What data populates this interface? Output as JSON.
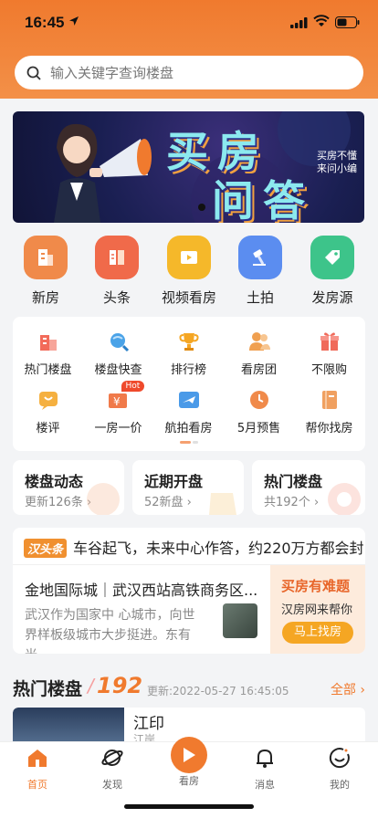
{
  "status": {
    "time": "16:45"
  },
  "search": {
    "placeholder": "输入关键字查询楼盘"
  },
  "banner": {
    "title_line1": "买房",
    "title_line2": "问答",
    "side_text": "买房不懂来问小编"
  },
  "categories": [
    {
      "label": "新房",
      "icon": "building-icon",
      "color": "#f08a4a"
    },
    {
      "label": "头条",
      "icon": "news-icon",
      "color": "#f06a4a"
    },
    {
      "label": "视频看房",
      "icon": "video-icon",
      "color": "#f5b82a"
    },
    {
      "label": "土拍",
      "icon": "gavel-icon",
      "color": "#5b8df0"
    },
    {
      "label": "发房源",
      "icon": "tag-icon",
      "color": "#3dc48a"
    }
  ],
  "grid": [
    {
      "label": "热门楼盘",
      "icon": "hot-building-icon",
      "color": "#f26b5a"
    },
    {
      "label": "楼盘快查",
      "icon": "search-globe-icon",
      "color": "#4aa3e8"
    },
    {
      "label": "排行榜",
      "icon": "trophy-icon",
      "color": "#f5a623"
    },
    {
      "label": "看房团",
      "icon": "group-icon",
      "color": "#f0a050"
    },
    {
      "label": "不限购",
      "icon": "gift-icon",
      "color": "#f06a5a"
    },
    {
      "label": "楼评",
      "icon": "comment-icon",
      "color": "#f5b040"
    },
    {
      "label": "一房一价",
      "icon": "price-icon",
      "color": "#f07a4a",
      "badge": "Hot"
    },
    {
      "label": "航拍看房",
      "icon": "plane-icon",
      "color": "#4a9ae8"
    },
    {
      "label": "5月预售",
      "icon": "clock-icon",
      "color": "#f08a4a"
    },
    {
      "label": "帮你找房",
      "icon": "book-icon",
      "color": "#f0a060"
    }
  ],
  "stats": [
    {
      "title": "楼盘动态",
      "sub": "更新126条"
    },
    {
      "title": "近期开盘",
      "sub": "52新盘"
    },
    {
      "title": "热门楼盘",
      "sub": "共192个"
    }
  ],
  "news": {
    "tag": "汉头条",
    "headline": "车谷起飞，未来中心作答，约220万方都会封",
    "title": "金地国际城｜武汉西站高铁商务区...",
    "body": "武汉作为国家中 心城市，向世界样板级城市大步挺进。东有光...",
    "promo_title": "买房有难题",
    "promo_sub": "汉房网来帮你",
    "promo_button": "马上找房"
  },
  "hot_section": {
    "title": "热门楼盘",
    "count": "192",
    "updated": "更新:2022-05-27 16:45:05",
    "all_label": "全部"
  },
  "listing": {
    "name": "江印",
    "sub": "江岸"
  },
  "tabbar": [
    {
      "label": "首页",
      "icon": "home-icon",
      "active": true
    },
    {
      "label": "发现",
      "icon": "planet-icon",
      "active": false
    },
    {
      "label": "看房",
      "icon": "play-icon",
      "active": false
    },
    {
      "label": "消息",
      "icon": "bell-icon",
      "active": false
    },
    {
      "label": "我的",
      "icon": "smile-icon",
      "active": false
    }
  ],
  "colors": {
    "brand": "#f07a2e"
  }
}
